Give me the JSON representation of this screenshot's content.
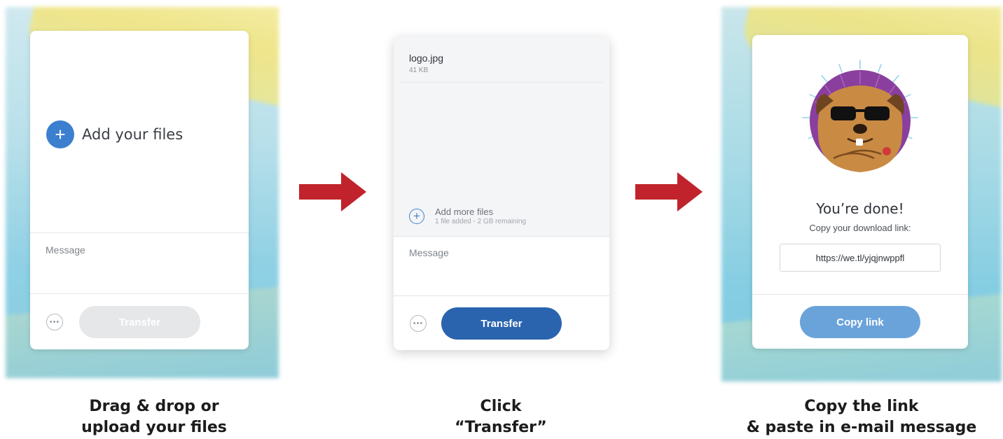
{
  "steps": [
    {
      "add_files_label": "Add your files",
      "message_placeholder": "Message",
      "transfer_label": "Transfer",
      "caption_line1": "Drag & drop or",
      "caption_line2": "upload your files"
    },
    {
      "file_name": "logo.jpg",
      "file_size": "41 KB",
      "add_more_label": "Add more files",
      "add_more_status": "1 file added - 2 GB remaining",
      "message_placeholder": "Message",
      "transfer_label": "Transfer",
      "caption_line1": "Click",
      "caption_line2": "“Transfer”"
    },
    {
      "done_title": "You’re done!",
      "done_subtitle": "Copy your download link:",
      "download_link": "https://we.tl/yjqjnwppfl",
      "copy_link_label": "Copy link",
      "caption_line1": "Copy the link",
      "caption_line2": "& paste in e-mail message"
    }
  ],
  "icons": {
    "plus": "+",
    "more": "•••",
    "arrow": "arrow-right-icon",
    "mascot": "sunglasses-dog-illustration"
  },
  "colors": {
    "primary_blue": "#2a64ae",
    "light_blue": "#6aa3da",
    "disabled": "#e5e7e9",
    "arrow_red": "#c0232c"
  }
}
